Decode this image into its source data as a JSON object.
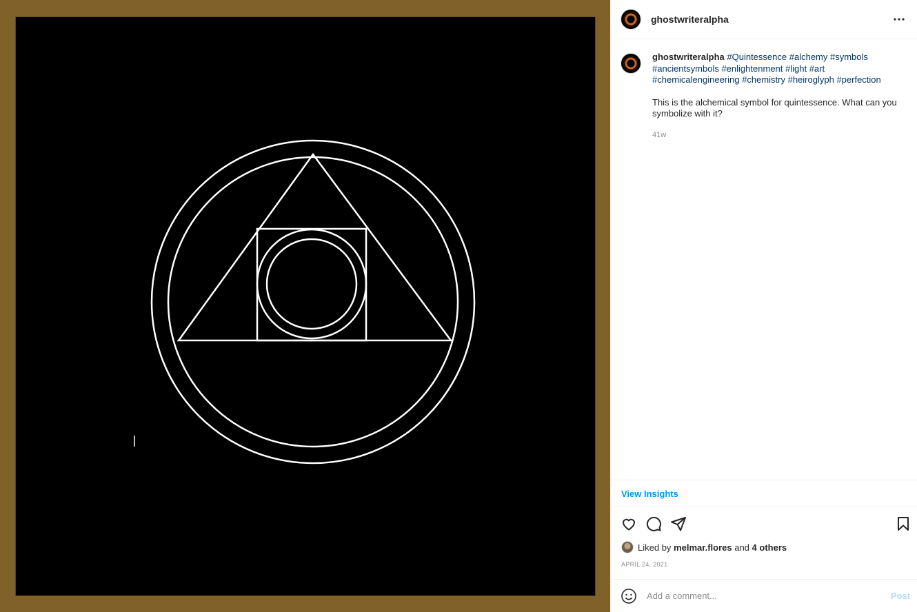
{
  "post": {
    "author": "ghostwriteralpha",
    "more_label": "•••"
  },
  "caption": {
    "author": "ghostwriteralpha",
    "hashtags": [
      "#Quintessence",
      "#alchemy",
      "#symbols",
      "#ancientsymbols",
      "#enlightenment",
      "#light",
      "#art",
      "#chemicalengineering",
      "#chemistry",
      "#heiroglyph",
      "#perfection"
    ],
    "text": "This is the alchemical symbol for quintessence. What can you symbolize with it?",
    "age": "41w"
  },
  "insights": {
    "label": "View Insights"
  },
  "likes": {
    "prefix": "Liked by",
    "user": "melmar.flores",
    "connector": "and",
    "others": "4 others"
  },
  "date": "APRIL 24, 2021",
  "comment": {
    "placeholder": "Add a comment...",
    "post_label": "Post"
  },
  "icons": [
    "heart-icon",
    "comment-icon",
    "share-icon",
    "bookmark-icon",
    "emoji-icon",
    "more-icon"
  ],
  "colors": {
    "frame": "#80612a",
    "link": "#0095f6",
    "hashtag": "#00376b",
    "post_disabled": "#b3dbff"
  }
}
